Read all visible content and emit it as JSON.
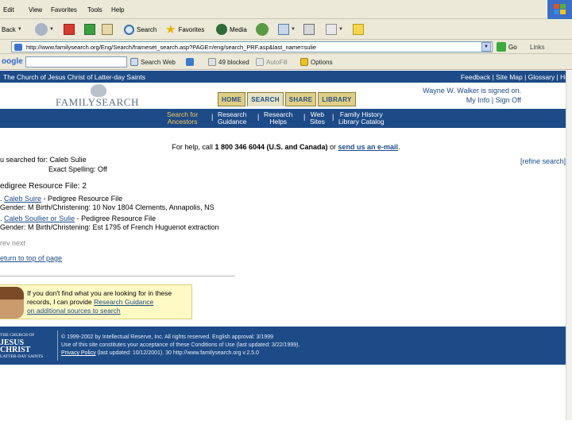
{
  "menubar": {
    "items": [
      "Edit",
      "View",
      "Favorites",
      "Tools",
      "Help"
    ]
  },
  "toolbar": {
    "back": "Back",
    "search": "Search",
    "favorites": "Favorites",
    "media": "Media"
  },
  "address": {
    "url": "http://www.familysearch.org/Eng/Search/frameset_search.asp?PAGE=/eng/search_PRF.asp&last_name=sulie",
    "go": "Go",
    "links": "Links"
  },
  "googlebar": {
    "logo": "oogle",
    "search_web": "Search Web",
    "blocked": "49 blocked",
    "autofill": "AutoFill",
    "options": "Options"
  },
  "site": {
    "org": "The Church of Jesus Christ of Latter-day Saints",
    "top_links": "Feedback | Site Map | Glossary | He",
    "logo": "FAMILYSEARCH",
    "tabs": [
      "HOME",
      "SEARCH",
      "SHARE",
      "LIBRARY"
    ],
    "signed_in": "Wayne W. Walker is signed on.",
    "account_links": "My Info | Sign Off",
    "subnav": [
      {
        "line1": "Search for",
        "line2": "Ancestors"
      },
      {
        "line1": "Research",
        "line2": "Guidance"
      },
      {
        "line1": "Research",
        "line2": "Helps"
      },
      {
        "line1": "Web",
        "line2": "Sites"
      },
      {
        "line1": "Family History",
        "line2": "Library Catalog"
      }
    ]
  },
  "help": {
    "prefix": "For help, call ",
    "phone": "1 800 346 6044 (U.S. and Canada)",
    "middle": " or ",
    "link": "send us an e-mail",
    "suffix": "."
  },
  "search": {
    "searched_for_label": "u searched for: ",
    "searched_name": "Caleb Sulie",
    "exact_spelling": "Exact Spelling: Off",
    "refine": "[refine search]"
  },
  "results": {
    "section_title": "edigree Resource File: 2",
    "items": [
      {
        "index": ".",
        "name": "Caleb Suire",
        "source": " - Pedigree Resource File",
        "detail": "Gender: M Birth/Christening: 10 Nov 1804 Clements, Annapolis, NS"
      },
      {
        "index": ".",
        "name": "Caleb Soullier or Sulie",
        "source": " - Pedigree Resource File",
        "detail": "Gender: M Birth/Christening: Est 1795 of French Huguenot extraction"
      }
    ],
    "prev_next": "rev  next",
    "return_top": "eturn to top of page"
  },
  "assistant": {
    "line1": "If you don't find what you are looking for in these",
    "line2_prefix": "records, I can provide ",
    "line2_link": "Research Guidance",
    "line3_link": "on additional sources to search"
  },
  "footer": {
    "church_small_1": "THE CHURCH OF",
    "church_large": "JESUS CHRIST",
    "church_small_2": "LATTER-DAY SAINTS",
    "legal_1": "© 1999-2002 by Intellectual Reserve, Inc. All rights reserved. English approval: 3/1999",
    "legal_2": "Use of this site constitutes your acceptance of these Conditions of Use (last updated: 3/22/1999).",
    "privacy_link": "Privacy Policy",
    "legal_3": " (last updated: 10/12/2001). 30 http://www.familysearch.org v.2.5.0"
  }
}
